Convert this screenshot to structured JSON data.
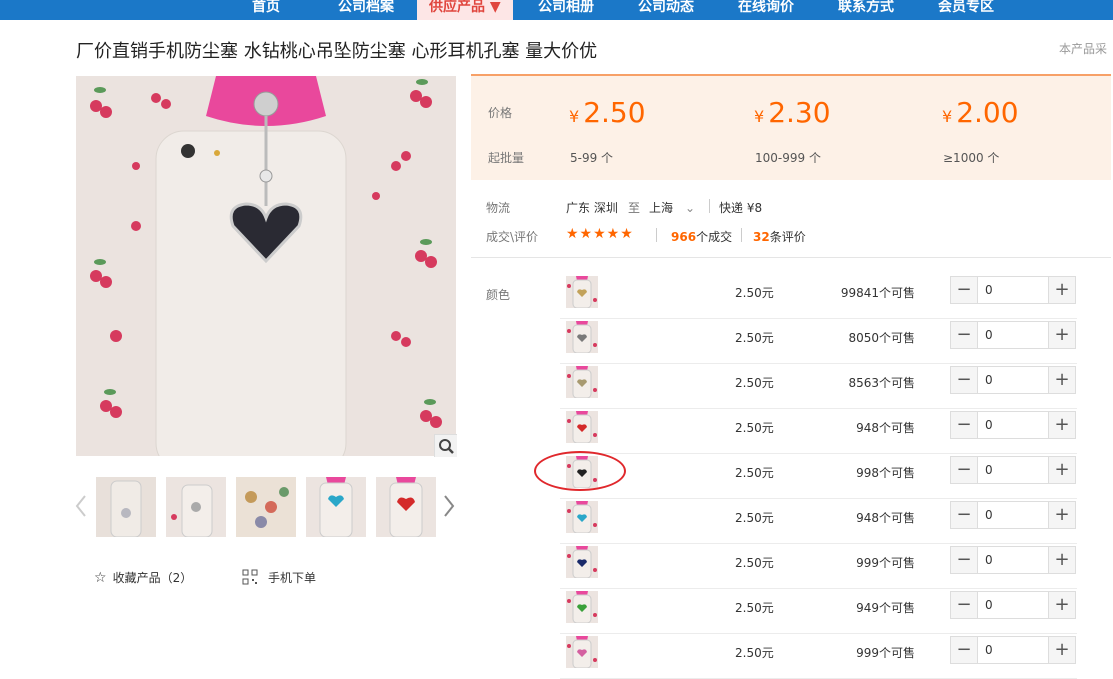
{
  "nav": {
    "items": [
      "首页",
      "公司档案",
      "供应产品 ▼",
      "公司相册",
      "公司动态",
      "在线询价",
      "联系方式",
      "会员专区"
    ]
  },
  "product": {
    "title": "厂价直销手机防尘塞 水钻桃心吊坠防尘塞 心形耳机孔塞 量大价优",
    "notice": "本产品采"
  },
  "price_box": {
    "price_label": "价格",
    "moq_label": "起批量",
    "currency": "¥",
    "tiers": [
      {
        "price": "2.50",
        "range": "5-99 个"
      },
      {
        "price": "2.30",
        "range": "100-999 个"
      },
      {
        "price": "2.00",
        "range": "≥1000 个"
      }
    ]
  },
  "logistics": {
    "label": "物流",
    "from": "广东 深圳",
    "to_word": "至",
    "dest": "上海",
    "express": "快递 ¥8"
  },
  "reviews": {
    "label": "成交\\评价",
    "stars": "★★★★★",
    "deals_count": "966",
    "deals_label": "个成交",
    "review_count": "32",
    "review_label": "条评价"
  },
  "sku": {
    "color_label": "颜色",
    "rows": [
      {
        "price": "2.50元",
        "stock": "99841个可售",
        "qty": "0",
        "swatch": "#c2a25a"
      },
      {
        "price": "2.50元",
        "stock": "8050个可售",
        "qty": "0",
        "swatch": "#7a7a7a"
      },
      {
        "price": "2.50元",
        "stock": "8563个可售",
        "qty": "0",
        "swatch": "#a89a70"
      },
      {
        "price": "2.50元",
        "stock": "948个可售",
        "qty": "0",
        "swatch": "#d42a2a"
      },
      {
        "price": "2.50元",
        "stock": "998个可售",
        "qty": "0",
        "swatch": "#222222"
      },
      {
        "price": "2.50元",
        "stock": "948个可售",
        "qty": "0",
        "swatch": "#2aa7c9"
      },
      {
        "price": "2.50元",
        "stock": "999个可售",
        "qty": "0",
        "swatch": "#1a2a6a"
      },
      {
        "price": "2.50元",
        "stock": "949个可售",
        "qty": "0",
        "swatch": "#3aa03a"
      },
      {
        "price": "2.50元",
        "stock": "999个可售",
        "qty": "0",
        "swatch": "#d460a0"
      }
    ],
    "minus": "−",
    "plus": "+"
  },
  "actions": {
    "favorite": "收藏产品（2）",
    "mobile_order": "手机下单"
  },
  "colors": {
    "nav_bg": "#1b78c8",
    "accent": "#ff6600",
    "price_bg": "#fdf1e7",
    "highlight_circle": "#e0282c"
  }
}
